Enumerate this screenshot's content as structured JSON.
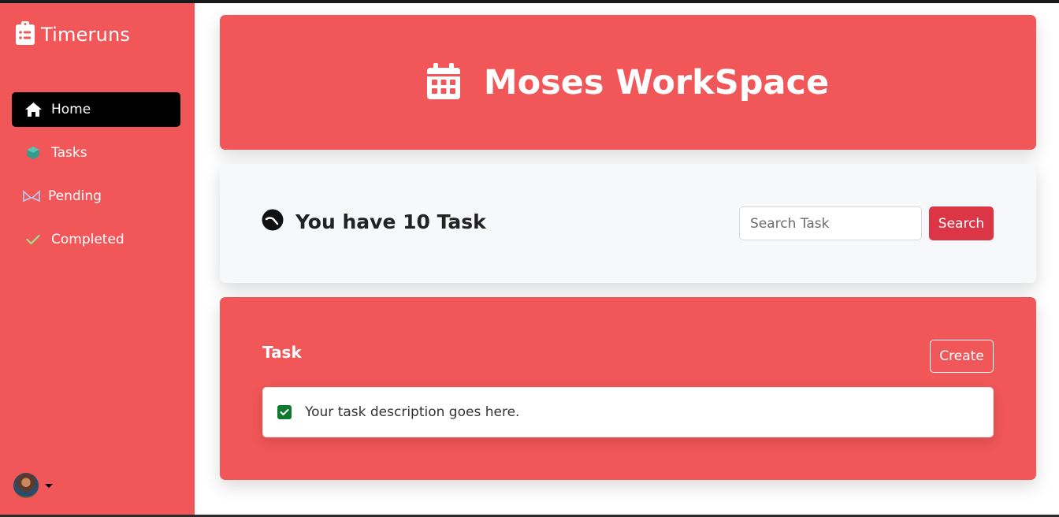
{
  "brand": {
    "name": "Timeruns",
    "icon": "clipboard-list-icon"
  },
  "sidebar": {
    "items": [
      {
        "label": "Home",
        "icon": "home-icon",
        "active": true
      },
      {
        "label": "Tasks",
        "icon": "cube-icon",
        "active": false
      },
      {
        "label": "Pending",
        "icon": "hourglass-icon",
        "active": false
      },
      {
        "label": "Completed",
        "icon": "check-icon",
        "active": false
      }
    ]
  },
  "hero": {
    "title": "Moses WorkSpace",
    "icon": "calendar-icon"
  },
  "summary": {
    "text": "You have 10 Task",
    "icon": "spinner-icon"
  },
  "search": {
    "placeholder": "Search Task",
    "value": "",
    "button_label": "Search"
  },
  "tasks": {
    "heading": "Task",
    "create_label": "Create",
    "items": [
      {
        "description": "Your task description goes here.",
        "checked": true
      }
    ]
  },
  "colors": {
    "brand_red": "#f15658",
    "button_red": "#dc3545",
    "active_nav": "#000000",
    "check_green": "#0f7a2e",
    "panel_bg": "#f7f8fa"
  }
}
